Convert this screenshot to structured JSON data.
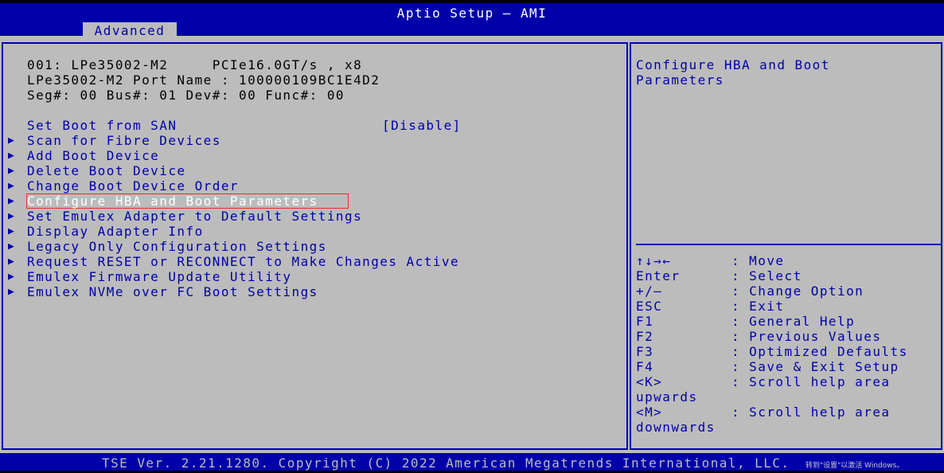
{
  "header": {
    "title": "Aptio Setup – AMI",
    "tab": "Advanced"
  },
  "info": {
    "line1": "001: LPe35002-M2     PCIe16.0GT/s , x8",
    "line2": "LPe35002-M2 Port Name : 100000109BC1E4D2",
    "line3": "Seg#: 00 Bus#: 01 Dev#: 00 Func#: 00"
  },
  "settings": {
    "boot_from_san_label": "Set Boot from SAN",
    "boot_from_san_value": "[Disable]"
  },
  "menu": {
    "arrow": "▶",
    "items": [
      "Scan for Fibre Devices",
      "Add Boot Device",
      "Delete Boot Device",
      "Change Boot Device Order",
      "Configure HBA and Boot Parameters",
      "Set Emulex Adapter to Default Settings",
      "Display Adapter Info",
      "Legacy Only Configuration Settings",
      "Request RESET or RECONNECT to Make Changes Active",
      "Emulex Firmware Update Utility",
      "Emulex NVMe over FC Boot Settings"
    ],
    "selected_index": 4
  },
  "help": {
    "line1": "Configure HBA and Boot",
    "line2": "Parameters"
  },
  "keys": [
    {
      "key": "↑↓→←",
      "desc": ": Move"
    },
    {
      "key": "Enter",
      "desc": ": Select"
    },
    {
      "key": "+/–",
      "desc": ": Change Option"
    },
    {
      "key": "ESC",
      "desc": ": Exit"
    },
    {
      "key": "F1",
      "desc": ": General Help"
    },
    {
      "key": "F2",
      "desc": ": Previous Values"
    },
    {
      "key": "F3",
      "desc": ": Optimized Defaults"
    },
    {
      "key": "F4",
      "desc": ": Save & Exit Setup"
    },
    {
      "key": "<K>",
      "desc": ": Scroll help area"
    },
    {
      "key": "upwards",
      "desc": ""
    },
    {
      "key": "<M>",
      "desc": ": Scroll help area"
    },
    {
      "key": "downwards",
      "desc": ""
    }
  ],
  "footer": {
    "text": "TSE Ver. 2.21.1280. Copyright (C) 2022 American Megatrends International, LLC.",
    "watermark": "转到\"设置\"以激活 Windows。"
  },
  "colors": {
    "background": "#bcbcbc",
    "accent_blue": "#0000aa",
    "selected_text": "#ffffff",
    "selection_outline": "#e03030"
  }
}
